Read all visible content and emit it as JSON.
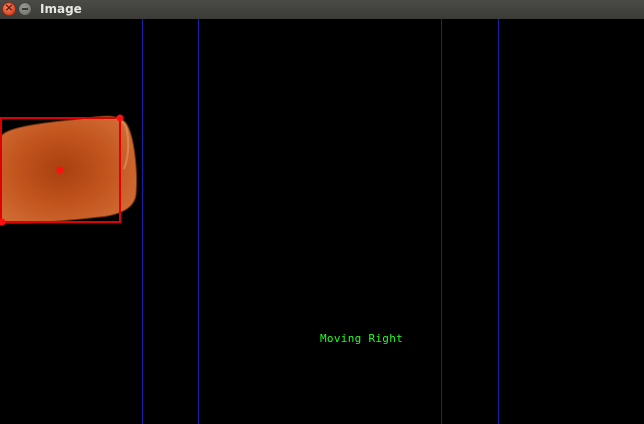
{
  "window": {
    "title": "Image",
    "close_icon": "close-icon",
    "minimize_icon": "minimize-icon"
  },
  "overlay": {
    "status_text": "Moving Right",
    "status_color": "#22ff22",
    "zone_line_color": "#1c1ca8",
    "bbox_color": "#e00000",
    "object_color": "#c2541e"
  }
}
